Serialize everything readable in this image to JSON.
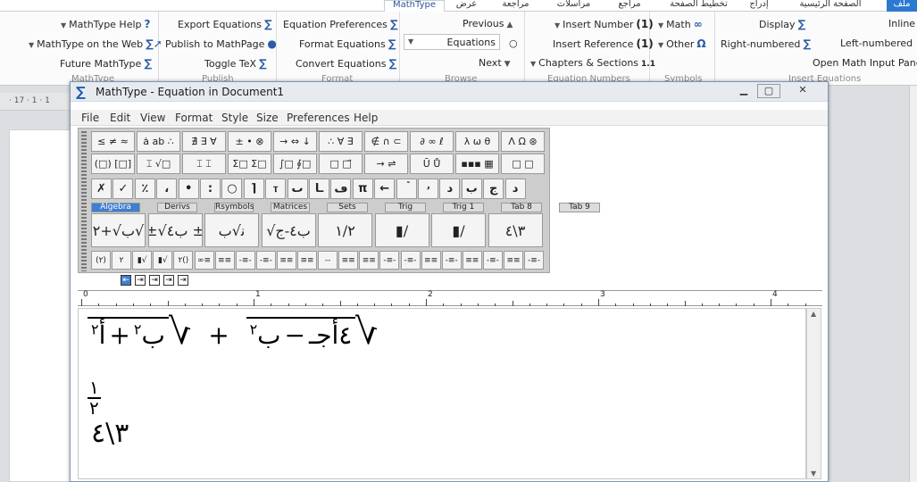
{
  "word_tabs": [
    {
      "label": "ملف",
      "state": "blue"
    },
    {
      "label": "الصفحة الرئيسية",
      "state": ""
    },
    {
      "label": "إدراج",
      "state": ""
    },
    {
      "label": "تخطيط الصفحة",
      "state": ""
    },
    {
      "label": "مراجع",
      "state": ""
    },
    {
      "label": "مراسلات",
      "state": ""
    },
    {
      "label": "مراجعة",
      "state": ""
    },
    {
      "label": "عرض",
      "state": ""
    },
    {
      "label": "MathType",
      "state": "active"
    }
  ],
  "ribbon": {
    "mathtype_group": {
      "items": [
        "MathType Help",
        "MathType on the Web",
        "Future MathType"
      ],
      "label": "MathType"
    },
    "publish_group": {
      "items": [
        "Export Equations",
        "Publish to MathPage",
        "Toggle TeX"
      ],
      "label": "Publish"
    },
    "format_group": {
      "items": [
        "Equation Preferences",
        "Format Equations",
        "Convert Equations"
      ],
      "label": "Format"
    },
    "browse_group": {
      "previous": "Previous",
      "equations": "Equations",
      "next": "Next",
      "label": "Browse"
    },
    "equation_numbers_group": {
      "items": [
        "Insert Number",
        "Insert Reference",
        "Chapters & Sections"
      ],
      "numbers_icon": "(1)",
      "chapter_icon": "1.1",
      "label": "Equation Numbers"
    },
    "symbols_group": {
      "items": [
        "Math",
        "Other"
      ],
      "label": "Symbols"
    },
    "insert_group": {
      "items": [
        "Display",
        "Inline",
        "Right-numbered",
        "Left-numbered",
        "Open Math Input Panel"
      ],
      "label": "Insert Equations"
    }
  },
  "doc_ruler_left": "· 17 · 1 · 1",
  "mathtype_window": {
    "title": "MathType - Equation in Document1",
    "menu": [
      "File",
      "Edit",
      "View",
      "Format",
      "Style",
      "Size",
      "Preferences",
      "Help"
    ],
    "palette_row1": [
      "≤ ≠ ≈",
      "ȧ ab ∴",
      "∄ ∃ ∀",
      "± • ⊗",
      "→ ⇔ ↓",
      "∴ ∀ ∃",
      "∉ ∩ ⊂",
      "∂ ∞ ℓ",
      "λ ω θ",
      "Λ Ω ⊛"
    ],
    "palette_row2": [
      "(□) [□]",
      "⌶ √□",
      "⌶ ⌶",
      "Σ□ Σ□",
      "∫□ ∮□",
      "□ □⃗",
      "→ ⇌",
      "Ū Ů",
      "▪▪▪ ▦",
      "□ □"
    ],
    "palette_row3": [
      "✗",
      "✓",
      "٪",
      "،",
      "•",
      ":",
      "○",
      "⌉",
      "ⲧ",
      "ٮ",
      "ـا",
      "ڡ",
      "π",
      "←",
      "ۡ",
      "ۥ",
      "ﺩ",
      "ﺏ",
      "ﺝ",
      "ﺩ"
    ],
    "palette_tabs": [
      "Algebra",
      "Derivs",
      "Rsymbols",
      "Matrices",
      "Sets",
      "Trig",
      "Trig 1",
      "Tab 8",
      "Tab 9"
    ],
    "palette_row4": [
      "ب√+۲√",
      "±√ب٤ ±",
      "ﻧ√ب",
      "√ب٤-ج",
      "۱/۲",
      "▮/",
      "▮/",
      "٤\\۳"
    ],
    "palette_row5": [
      "(۲)",
      "۲",
      "▮√",
      "▮√",
      "۲()",
      "∞≡",
      "≡≡",
      "-≡-",
      "-≡-",
      "≡≡",
      "≡≡",
      "--",
      "≡≡",
      "≡≡",
      "-≡-",
      "-≡-",
      "≡≡",
      "-≡-",
      "≡≡",
      "-≡-",
      "≡≡",
      "-≡-"
    ],
    "tabstops": [
      "⇤",
      "⇥",
      "⇥",
      "⇥",
      "⇥"
    ],
    "ruler_numbers": [
      "0",
      "1",
      "2",
      "3",
      "4"
    ],
    "equation": {
      "line1_left_radicand": "ب",
      "line1_left_exp": "۲",
      "line1_left_op": "+",
      "line1_left_a": "أ",
      "line1_left_a_exp": "۲",
      "line1_plus": "+",
      "line1_right_radicand": "ب",
      "line1_right_exp": "۲",
      "line1_right_op": "−",
      "line1_right_rest": "٤أجـ",
      "line2_num": "۱",
      "line2_den": "۲",
      "line3": "٤\\۳"
    }
  }
}
